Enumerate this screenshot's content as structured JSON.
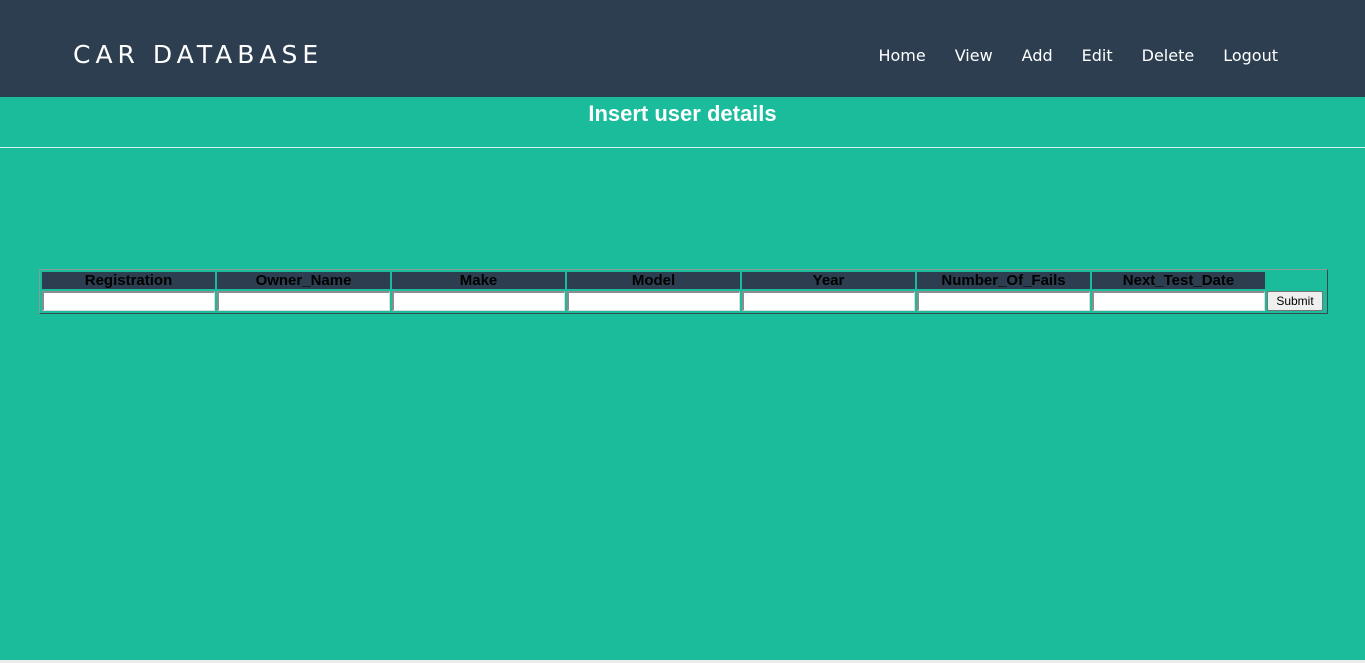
{
  "header": {
    "brand": "CAR DATABASE",
    "nav": [
      "Home",
      "View",
      "Add",
      "Edit",
      "Delete",
      "Logout"
    ]
  },
  "main": {
    "title": "Insert user details",
    "form": {
      "columns": [
        "Registration",
        "Owner_Name",
        "Make",
        "Model",
        "Year",
        "Number_Of_Fails",
        "Next_Test_Date"
      ],
      "values": [
        "",
        "",
        "",
        "",
        "",
        "",
        ""
      ],
      "submit_label": "Submit"
    }
  },
  "colors": {
    "header_bg": "#2c3e50",
    "page_bg": "#1abc9c",
    "table_header_bg": "#2c3e50"
  }
}
